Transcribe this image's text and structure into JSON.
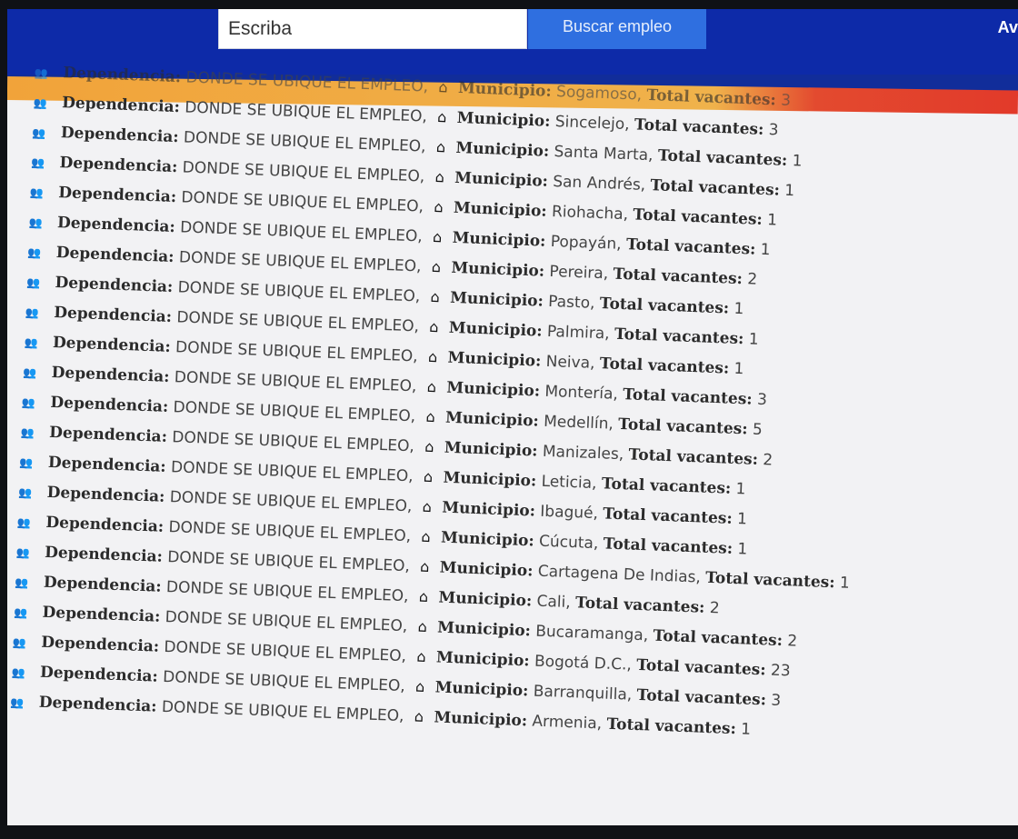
{
  "header": {
    "search_value": "Escriba",
    "search_button": "Buscar empleo",
    "right_text": "Av"
  },
  "labels": {
    "dependencia": "Dependencia:",
    "municipio": "Municipio:",
    "total": "Total vacantes:"
  },
  "rows": [
    {
      "dependencia": "DONDE SE UBIQUE EL EMPLEO,",
      "municipio": "Sogamoso,",
      "vacantes": "3"
    },
    {
      "dependencia": "DONDE SE UBIQUE EL EMPLEO,",
      "municipio": "Sincelejo,",
      "vacantes": "3"
    },
    {
      "dependencia": "DONDE SE UBIQUE EL EMPLEO,",
      "municipio": "Santa Marta,",
      "vacantes": "1"
    },
    {
      "dependencia": "DONDE SE UBIQUE EL EMPLEO,",
      "municipio": "San Andrés,",
      "vacantes": "1"
    },
    {
      "dependencia": "DONDE SE UBIQUE EL EMPLEO,",
      "municipio": "Riohacha,",
      "vacantes": "1"
    },
    {
      "dependencia": "DONDE SE UBIQUE EL EMPLEO,",
      "municipio": "Popayán,",
      "vacantes": "1"
    },
    {
      "dependencia": "DONDE SE UBIQUE EL EMPLEO,",
      "municipio": "Pereira,",
      "vacantes": "2"
    },
    {
      "dependencia": "DONDE SE UBIQUE EL EMPLEO,",
      "municipio": "Pasto,",
      "vacantes": "1"
    },
    {
      "dependencia": "DONDE SE UBIQUE EL EMPLEO,",
      "municipio": "Palmira,",
      "vacantes": "1"
    },
    {
      "dependencia": "DONDE SE UBIQUE EL EMPLEO,",
      "municipio": "Neiva,",
      "vacantes": "1"
    },
    {
      "dependencia": "DONDE SE UBIQUE EL EMPLEO,",
      "municipio": "Montería,",
      "vacantes": "3"
    },
    {
      "dependencia": "DONDE SE UBIQUE EL EMPLEO,",
      "municipio": "Medellín,",
      "vacantes": "5"
    },
    {
      "dependencia": "DONDE SE UBIQUE EL EMPLEO,",
      "municipio": "Manizales,",
      "vacantes": "2"
    },
    {
      "dependencia": "DONDE SE UBIQUE EL EMPLEO,",
      "municipio": "Leticia,",
      "vacantes": "1"
    },
    {
      "dependencia": "DONDE SE UBIQUE EL EMPLEO,",
      "municipio": "Ibagué,",
      "vacantes": "1"
    },
    {
      "dependencia": "DONDE SE UBIQUE EL EMPLEO,",
      "municipio": "Cúcuta,",
      "vacantes": "1"
    },
    {
      "dependencia": "DONDE SE UBIQUE EL EMPLEO,",
      "municipio": "Cartagena De Indias,",
      "vacantes": "1"
    },
    {
      "dependencia": "DONDE SE UBIQUE EL EMPLEO,",
      "municipio": "Cali,",
      "vacantes": "2"
    },
    {
      "dependencia": "DONDE SE UBIQUE EL EMPLEO,",
      "municipio": "Bucaramanga,",
      "vacantes": "2"
    },
    {
      "dependencia": "DONDE SE UBIQUE EL EMPLEO,",
      "municipio": "Bogotá D.C.,",
      "vacantes": "23"
    },
    {
      "dependencia": "DONDE SE UBIQUE EL EMPLEO,",
      "municipio": "Barranquilla,",
      "vacantes": "3"
    },
    {
      "dependencia": "DONDE SE UBIQUE EL EMPLEO,",
      "municipio": "Armenia,",
      "vacantes": "1"
    }
  ],
  "icons": {
    "users": "users-icon",
    "home": "home-icon"
  },
  "colors": {
    "header_blue": "#0d2aa8",
    "button_blue": "#2f6fe0",
    "stripe_orange": "#f1a33a",
    "stripe_red": "#e23a2a"
  }
}
